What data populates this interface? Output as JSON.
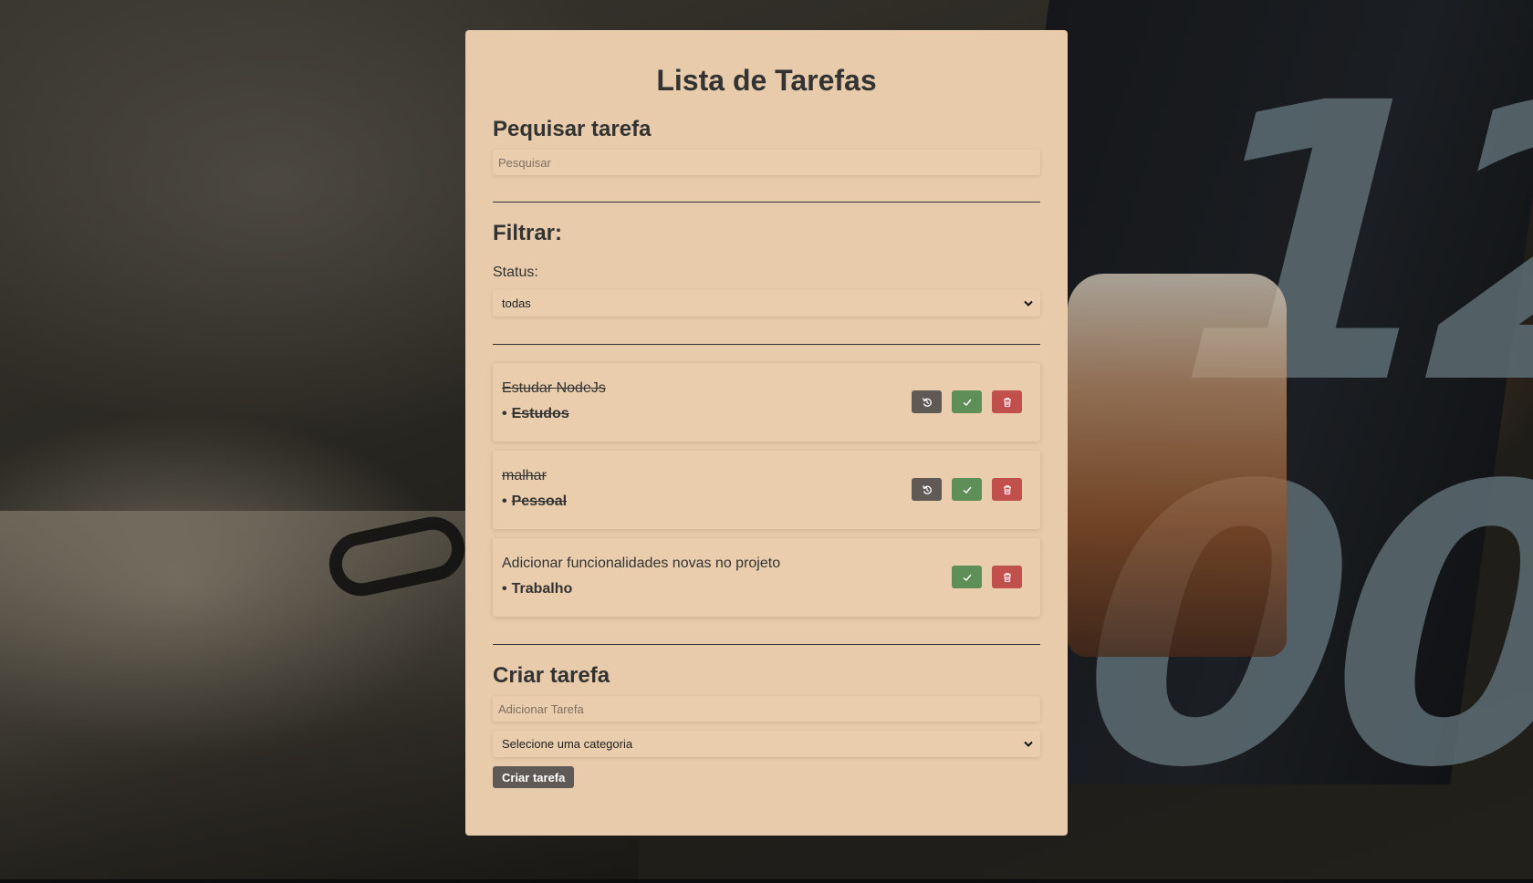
{
  "page": {
    "title": "Lista de Tarefas"
  },
  "search": {
    "heading": "Pequisar tarefa",
    "placeholder": "Pesquisar",
    "value": ""
  },
  "filter": {
    "heading": "Filtrar:",
    "status_label": "Status:",
    "status_selected": "todas"
  },
  "todos": [
    {
      "text": "Estudar NodeJs",
      "category": "Estudos",
      "completed": true
    },
    {
      "text": "malhar",
      "category": "Pessoal",
      "completed": true
    },
    {
      "text": "Adicionar funcionalidades novas no projeto",
      "category": "Trabalho",
      "completed": false
    }
  ],
  "create": {
    "heading": "Criar tarefa",
    "input_placeholder": "Adicionar Tarefa",
    "category_selected": "Selecione uma categoria",
    "button_label": "Criar tarefa"
  },
  "icons": {
    "undo": "undo-icon",
    "complete": "check-icon",
    "delete": "trash-icon",
    "select_arrow": "chevron-down-icon"
  },
  "colors": {
    "card": "#e8cbaa",
    "undo_button": "#5f5a55",
    "complete_button": "#5e8f57",
    "delete_button": "#c14f4c"
  }
}
